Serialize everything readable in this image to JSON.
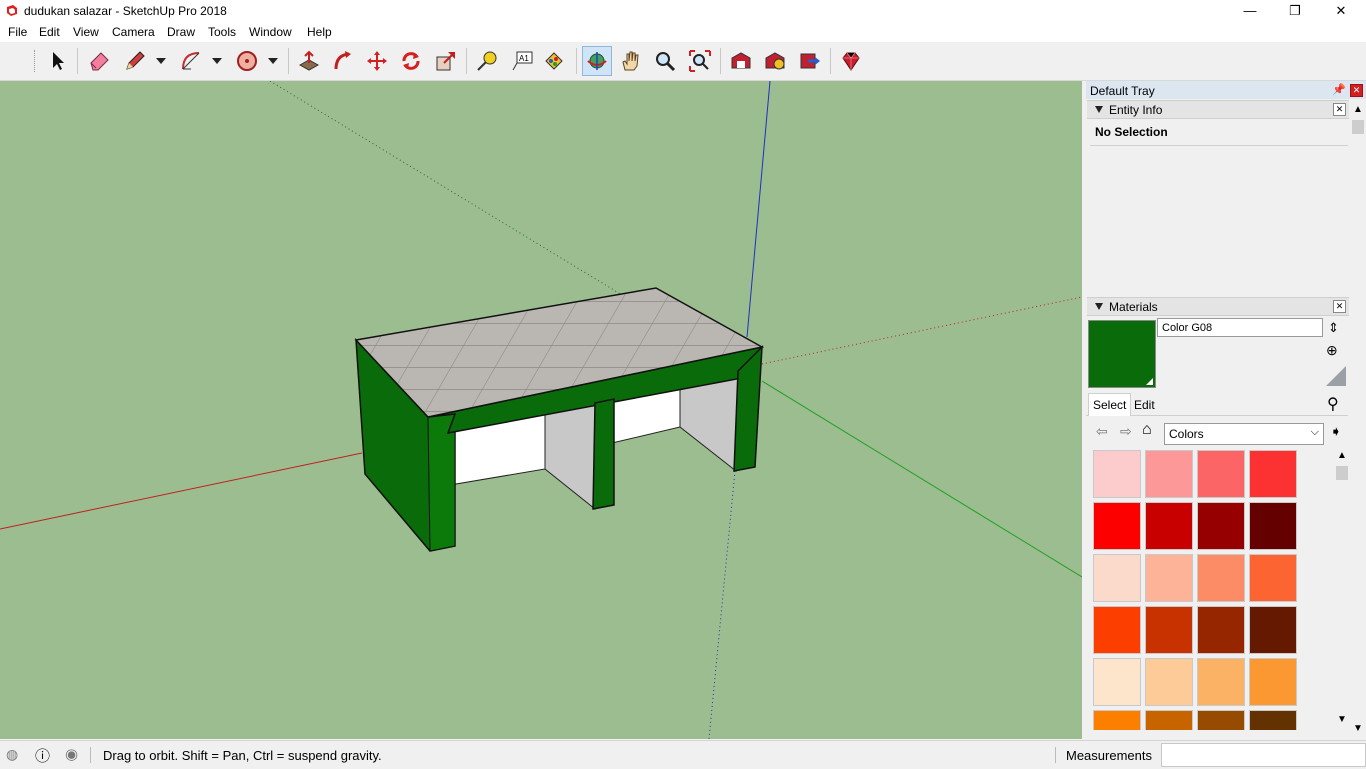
{
  "window": {
    "title": "dudukan salazar - SketchUp Pro 2018",
    "minimize": "—",
    "restore": "❐",
    "close": "✕"
  },
  "menu": [
    "File",
    "Edit",
    "View",
    "Camera",
    "Draw",
    "Tools",
    "Window",
    "Help"
  ],
  "tray": {
    "title": "Default Tray",
    "entity_info": {
      "header": "Entity Info",
      "selection": "No Selection"
    },
    "materials": {
      "header": "Materials",
      "current_name": "Color G08",
      "current_color": "#0a6b0a",
      "tab_select": "Select",
      "tab_edit": "Edit",
      "library": "Colors",
      "swatches": [
        [
          "#fccbcb",
          "#fc9898",
          "#fc6565",
          "#fc3232"
        ],
        [
          "#fc0000",
          "#c80000",
          "#960000",
          "#640000"
        ],
        [
          "#fcdacb",
          "#fcb398",
          "#fc8c65",
          "#fc6532"
        ],
        [
          "#fc3f00",
          "#c83200",
          "#962600",
          "#641900"
        ],
        [
          "#fce5cb",
          "#fccb98",
          "#fcb265",
          "#fc9832"
        ],
        [
          "#fc7f00",
          "#c86400",
          "#964b00",
          "#643200"
        ]
      ]
    }
  },
  "status": {
    "hint": "Drag to orbit. Shift = Pan, Ctrl = suspend gravity.",
    "measurements_label": "Measurements",
    "measurements_value": ""
  },
  "colors": {
    "viewport_bg": "#9bbd8f",
    "model_green": "#0a6b0a",
    "toolbar_active": "#cfe4f7"
  }
}
